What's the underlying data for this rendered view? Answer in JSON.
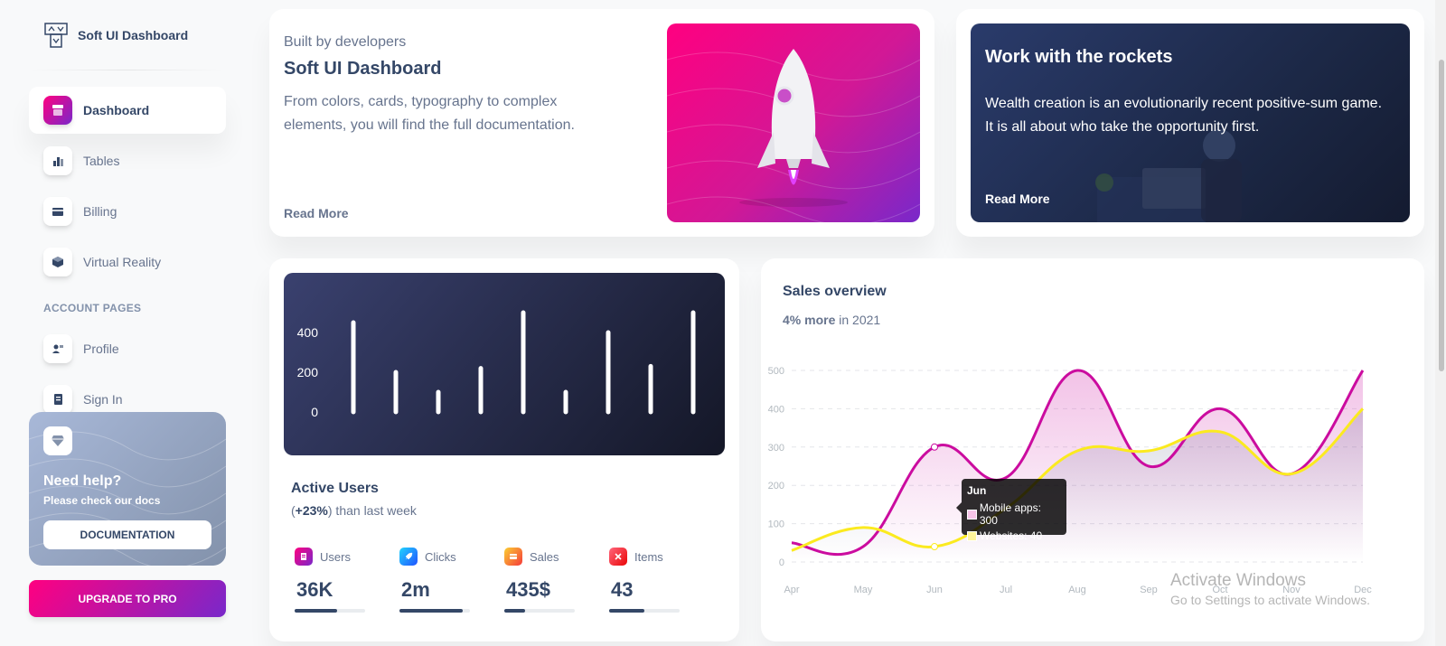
{
  "brand": {
    "name": "Soft UI Dashboard"
  },
  "sidebar": {
    "items": [
      {
        "label": "Dashboard",
        "icon": "shop-icon",
        "active": true
      },
      {
        "label": "Tables",
        "icon": "chart-bar-icon"
      },
      {
        "label": "Billing",
        "icon": "credit-card-icon"
      },
      {
        "label": "Virtual Reality",
        "icon": "box-3d-icon"
      }
    ],
    "section_label": "ACCOUNT PAGES",
    "account_items": [
      {
        "label": "Profile",
        "icon": "user-icon"
      },
      {
        "label": "Sign In",
        "icon": "document-icon"
      }
    ],
    "help": {
      "title": "Need help?",
      "subtitle": "Please check our docs",
      "button": "DOCUMENTATION",
      "icon": "diamond-icon"
    },
    "upgrade_button": "UPGRADE TO PRO"
  },
  "intro_card": {
    "subtitle": "Built by developers",
    "title": "Soft UI Dashboard",
    "text": "From colors, cards, typography to complex elements, you will find the full documentation.",
    "link": "Read More"
  },
  "rockets_card": {
    "title": "Work with the rockets",
    "text": "Wealth creation is an evolutionarily recent positive-sum game. It is all about who take the opportunity first.",
    "link": "Read More"
  },
  "active_users": {
    "title": "Active Users",
    "sub_open": "(",
    "sub_change": "+23%",
    "sub_close": ") than last week",
    "stats": [
      {
        "label": "Users",
        "value": "36K",
        "progress": 60,
        "color": "#ff0080",
        "icon": "document-icon"
      },
      {
        "label": "Clicks",
        "value": "2m",
        "progress": 90,
        "color": "#17c1e8",
        "icon": "rocket-icon"
      },
      {
        "label": "Sales",
        "value": "435$",
        "progress": 30,
        "color": "#f53939",
        "icon": "cart-icon"
      },
      {
        "label": "Items",
        "value": "43",
        "progress": 50,
        "color": "#ea0606",
        "icon": "tools-icon"
      }
    ]
  },
  "sales_overview": {
    "title": "Sales overview",
    "sub_bold": "4% more",
    "sub_rest": " in 2021",
    "tooltip": {
      "title": "Jun",
      "row1": "Mobile apps: 300",
      "row2": "Websites: 40"
    }
  },
  "chart_data": [
    {
      "type": "bar",
      "categories": [
        "",
        "",
        "",
        "",
        "",
        "",
        "",
        "",
        ""
      ],
      "values": [
        450,
        200,
        100,
        220,
        500,
        100,
        400,
        230,
        500
      ],
      "yticks": [
        0,
        200,
        400
      ],
      "ylim": [
        0,
        500
      ]
    },
    {
      "type": "line",
      "title": "Sales overview",
      "categories": [
        "Apr",
        "May",
        "Jun",
        "Jul",
        "Aug",
        "Sep",
        "Oct",
        "Nov",
        "Dec"
      ],
      "series": [
        {
          "name": "Mobile apps",
          "values": [
            50,
            40,
            300,
            220,
            500,
            250,
            400,
            230,
            500
          ],
          "color": "#cb0c9f"
        },
        {
          "name": "Websites",
          "values": [
            30,
            90,
            40,
            140,
            290,
            290,
            340,
            230,
            400
          ],
          "color": "#fbea1f"
        }
      ],
      "yticks": [
        0,
        100,
        200,
        300,
        400,
        500
      ],
      "ylim": [
        0,
        500
      ]
    }
  ],
  "watermark": {
    "line1": "Activate Windows",
    "line2": "Go to Settings to activate Windows."
  }
}
